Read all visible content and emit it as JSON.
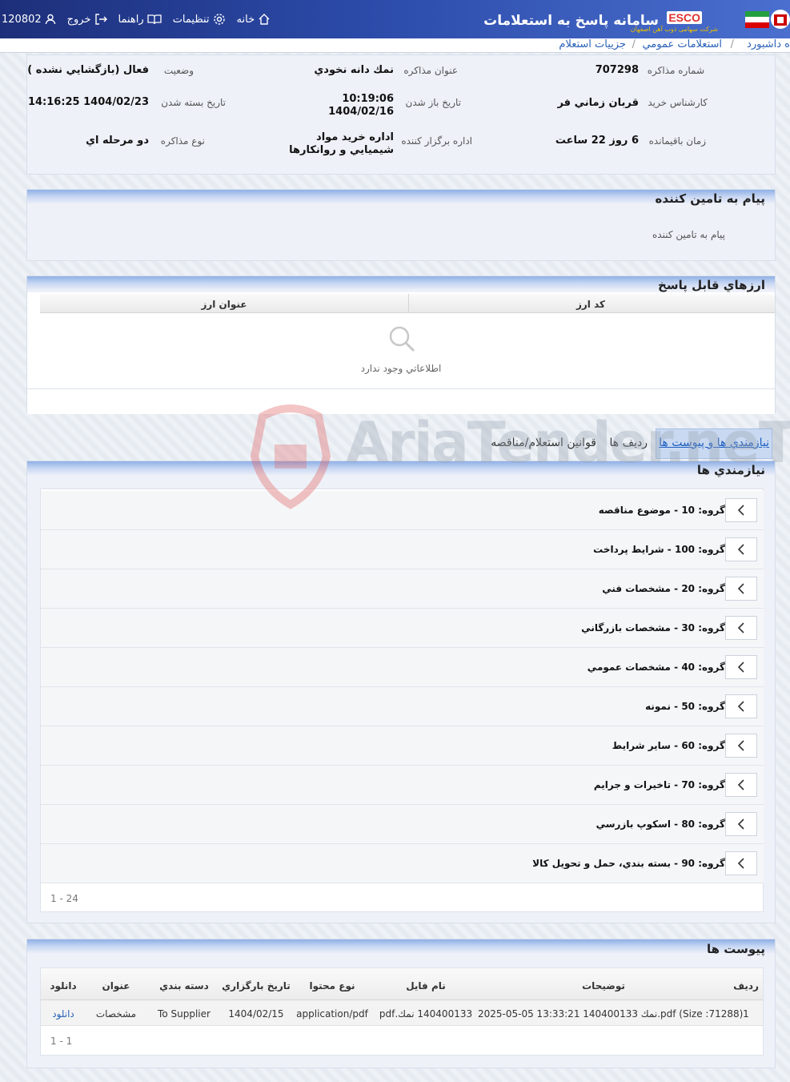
{
  "header": {
    "app_title": "سامانه پاسخ به استعلامات",
    "brand": "ESCO",
    "brand_sub": "شرکت سهامی ذوب آهن اصفهان",
    "nav": {
      "user_id": "120802",
      "logout": "خروج",
      "help": "راهنما",
      "settings": "تنظيمات",
      "home": "خانه"
    }
  },
  "breadcrumb": {
    "items": [
      "ه داشبورد",
      "استعلامات عمومي",
      "جزييات استعلام"
    ],
    "sep": "/"
  },
  "summary": {
    "negotiation_number_label": "شماره مذاکره",
    "negotiation_number": "707298",
    "title_label": "عنوان مذاکره",
    "title": "نمك دانه نخودي",
    "status_label": "وضعيت",
    "status": "فعال (بازگشايي نشده )",
    "expert_label": "کارشناس خريد",
    "expert": "قربان زماني فر",
    "open_date_label": "تاريخ باز شدن",
    "open_time": "10:19:06",
    "open_date": "1404/02/16",
    "close_date_label": "تاريخ بسته شدن",
    "close_date": "1404/02/23 14:16:25",
    "remaining_label": "زمان باقيمانده",
    "remaining": "6 روز 22 ساعت",
    "organizer_label": "اداره برگزار کننده",
    "organizer_line1": "اداره خريد مواد",
    "organizer_line2": "شيميايي و روانكارها",
    "type_label": "نوع مذاکره",
    "type": "دو مرحله اي"
  },
  "supplier_message": {
    "title": "پيام به تامين کننده",
    "text": "پيام به تامين کننده"
  },
  "currencies": {
    "title": "ارزهاي قابل پاسخ",
    "col_code": "کد ارز",
    "col_title": "عنوان ارز",
    "empty": "اطلاعاتي وجود ندارد"
  },
  "tabs": [
    "نيازمندي ها و پيوست ها",
    "رديف ها",
    "قوانين استعلام/مناقصه"
  ],
  "requirements": {
    "title": "نيازمندي ها",
    "groups": [
      "گروه: 10 - موضوع مناقصه",
      "گروه: 100 - شرايط پرداخت",
      "گروه: 20 - مشخصات فني",
      "گروه: 30 - مشخصات بازرگاني",
      "گروه: 40 - مشخصات عمومي",
      "گروه: 50 - نمونه",
      "گروه: 60 - ساير شرايط",
      "گروه: 70 - تاخيرات و جرايم",
      "گروه: 80 - اسکوپ بازرسي",
      "گروه: 90 - بسته بندي، حمل و تحويل كالا"
    ],
    "pager": "1 - 24"
  },
  "attachments": {
    "title": "پيوست ها",
    "headers": [
      "رديف",
      "توضيحات",
      "نام فايل",
      "نوع محتوا",
      "تاريخ بارگزاري",
      "دسته بندي",
      "عنوان",
      "دانلود"
    ],
    "rows": [
      [
        "1",
        "2025-05-05 13:33:21 140400133 نمك.pdf (Size :71288)",
        "140400133 نمك.pdf",
        "application/pdf",
        "1404/02/15",
        "To Supplier",
        "مشخصات",
        "دانلود"
      ]
    ],
    "pager": "1 - 1"
  },
  "watermark": "AriaTender.neT"
}
